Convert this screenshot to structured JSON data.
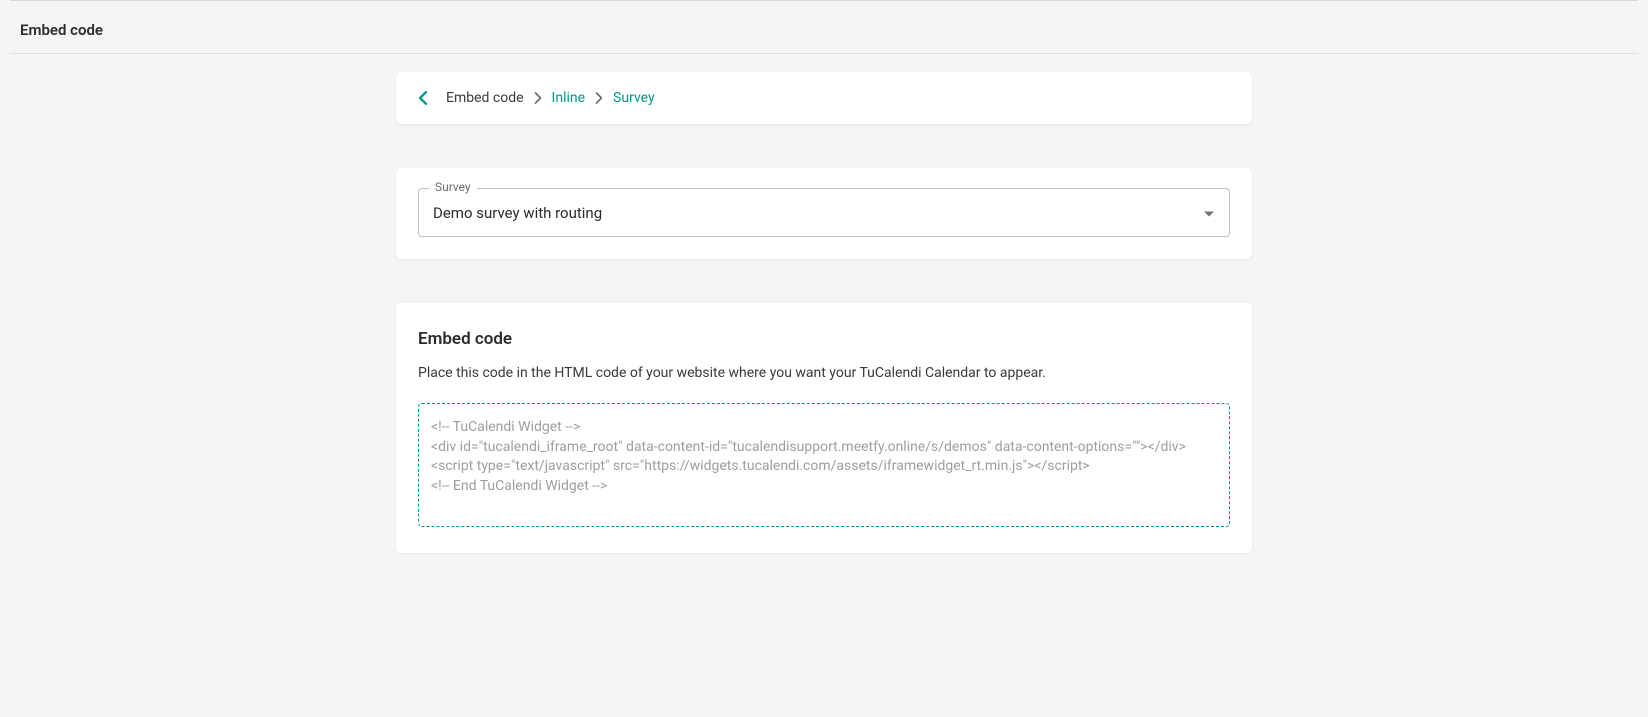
{
  "header": {
    "title": "Embed code"
  },
  "breadcrumb": {
    "root": "Embed code",
    "inline": "Inline",
    "survey": "Survey"
  },
  "survey_select": {
    "label": "Survey",
    "value": "Demo survey with routing"
  },
  "embed": {
    "title": "Embed code",
    "description": "Place this code in the HTML code of your website where you want your TuCalendi Calendar to appear.",
    "code": "<!-- TuCalendi Widget -->\n<div id=\"tucalendi_iframe_root\" data-content-id=\"tucalendisupport.meetfy.online/s/demos\" data-content-options=\"\"></div>\n<script type=\"text/javascript\" src=\"https://widgets.tucalendi.com/assets/iframewidget_rt.min.js\"></script>\n<!-- End TuCalendi Widget -->"
  }
}
